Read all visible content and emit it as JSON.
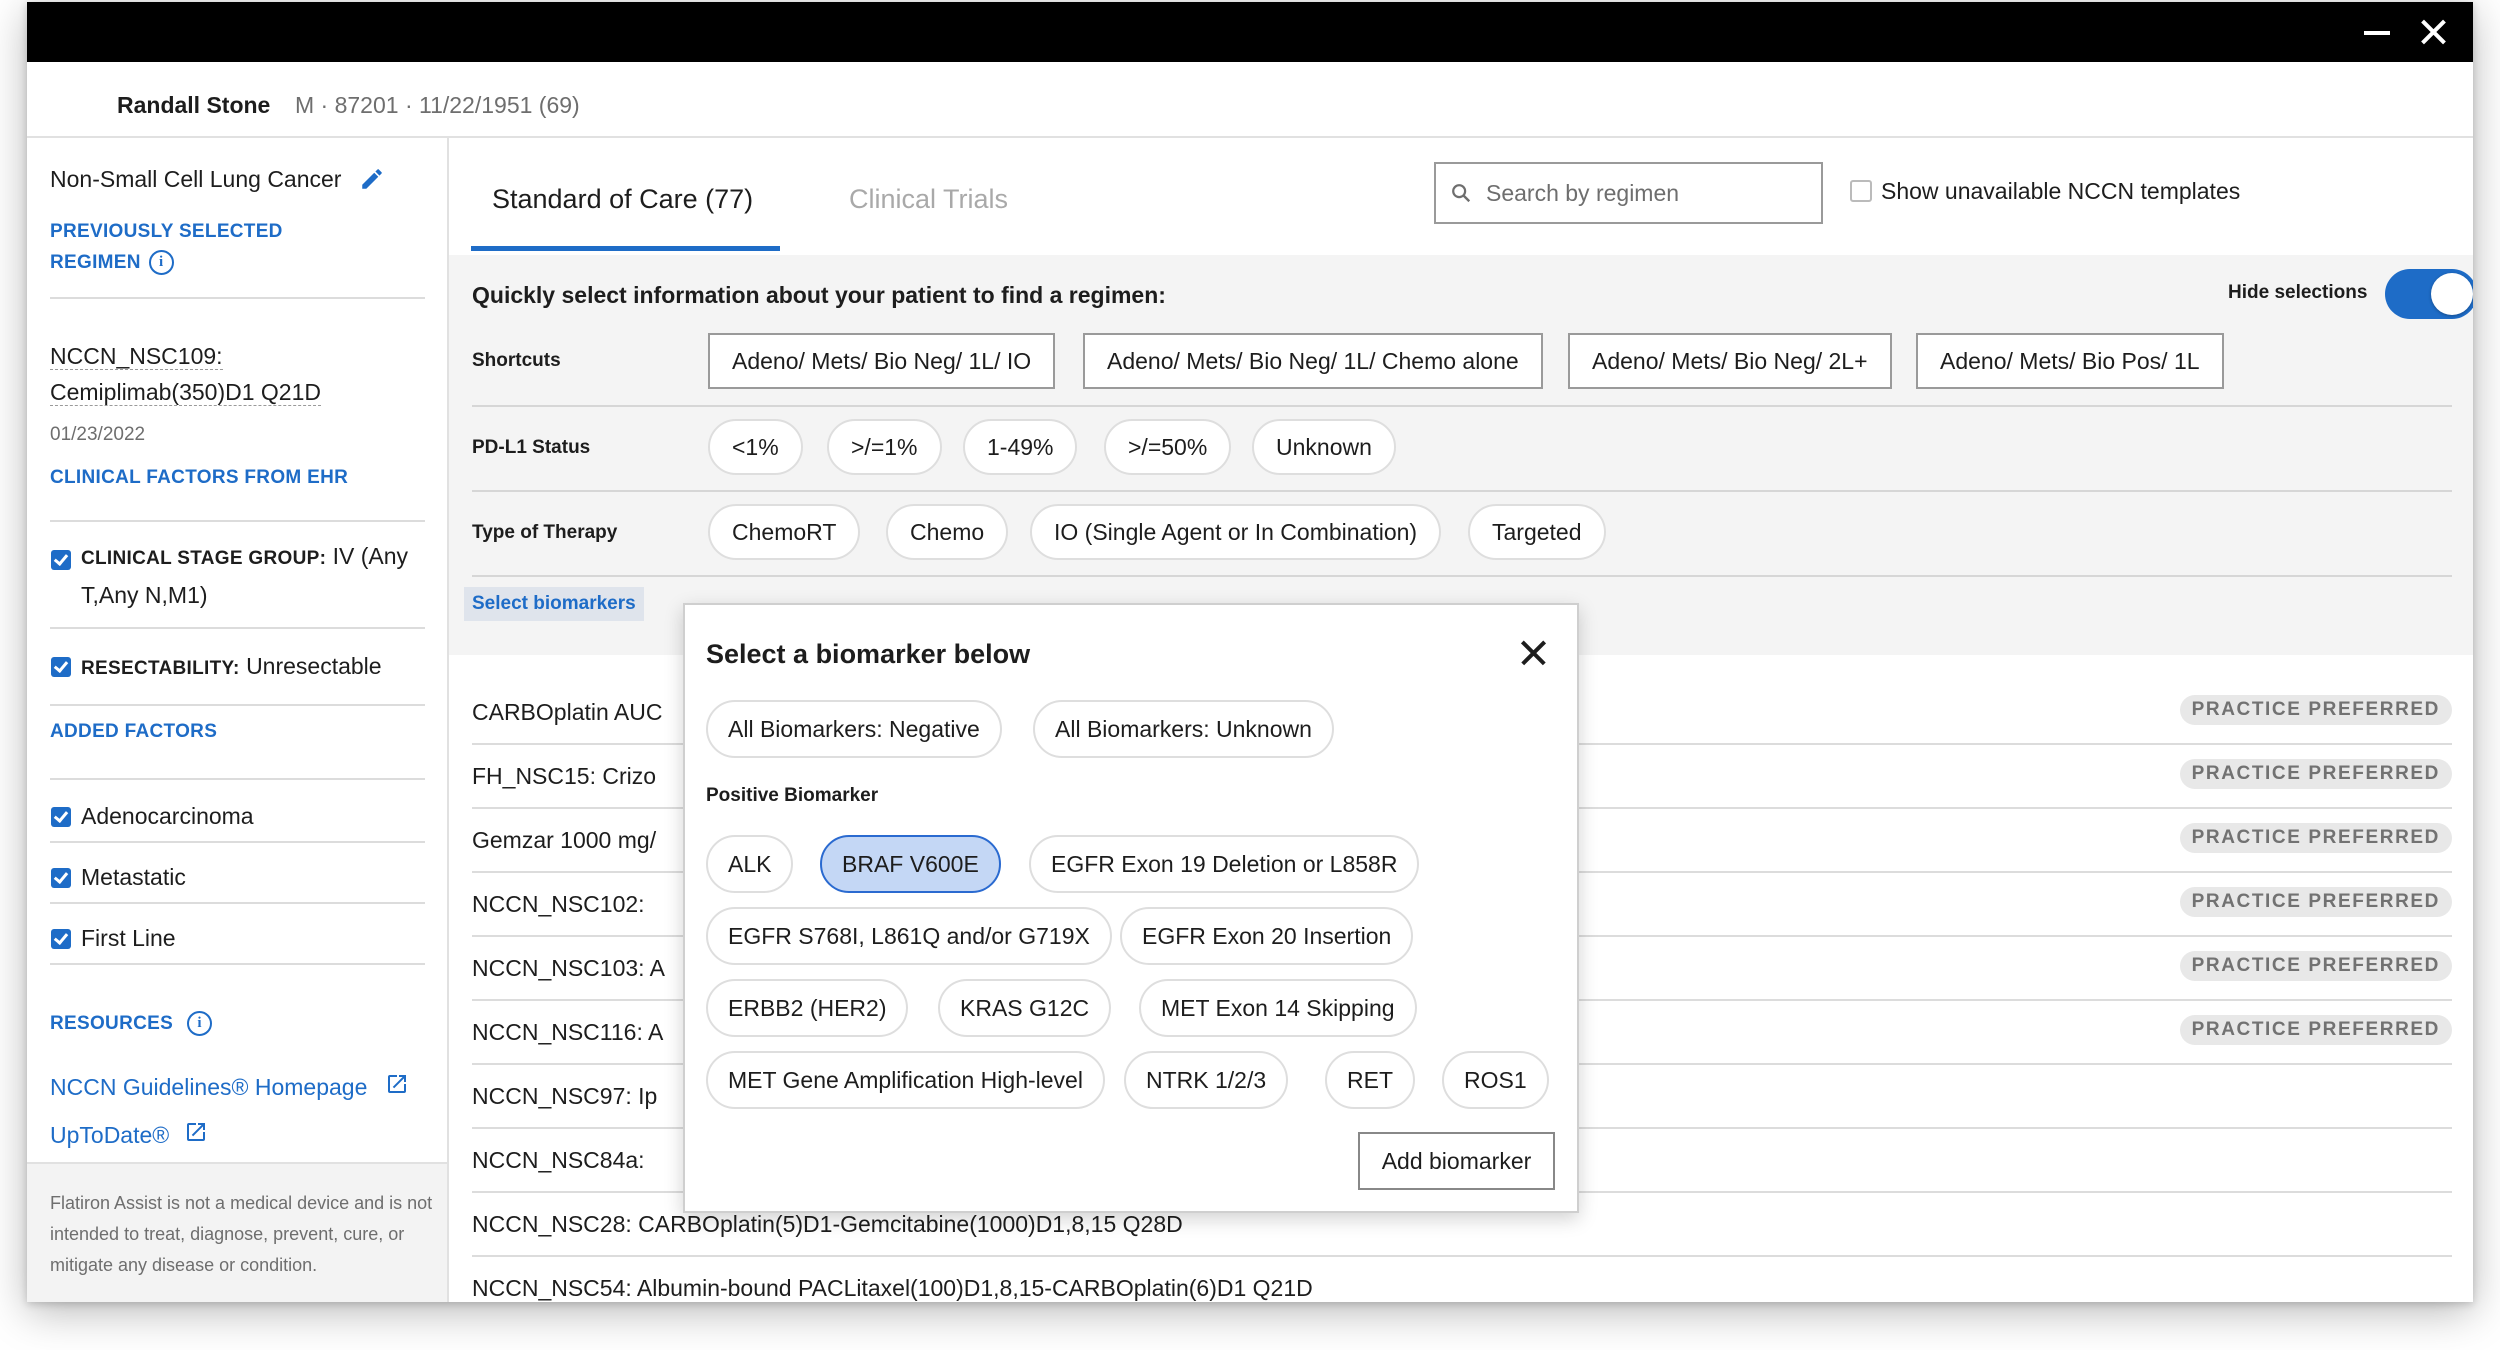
{
  "patient": {
    "name": "Randall Stone",
    "info": "M · 87201 · 11/22/1951 (69)"
  },
  "sidebar": {
    "diagnosis": "Non-Small Cell Lung Cancer",
    "previously_selected": {
      "title_line1": "PREVIOUSLY SELECTED",
      "title_line2": "REGIMEN",
      "regimen_line1": "NCCN_NSC109:",
      "regimen_line2": "Cemiplimab(350)D1 Q21D",
      "date": "01/23/2022"
    },
    "clinical_factors": {
      "title": "CLINICAL FACTORS FROM EHR",
      "items": [
        {
          "label": "CLINICAL STAGE GROUP:",
          "value_line1": "IV (Any",
          "value_line2": "T,Any N,M1)"
        },
        {
          "label": "RESECTABILITY:",
          "value": "Unresectable"
        }
      ]
    },
    "added_factors": {
      "title": "ADDED FACTORS",
      "items": [
        "Adenocarcinoma",
        "Metastatic",
        "First Line"
      ]
    },
    "resources": {
      "title": "RESOURCES",
      "links": [
        "NCCN Guidelines® Homepage",
        "UpToDate®"
      ]
    },
    "disclaimer": "Flatiron Assist is not a medical device and is not intended to treat, diagnose, prevent, cure, or mitigate any disease or condition."
  },
  "tabs": [
    {
      "label": "Standard of Care (77)",
      "active": true
    },
    {
      "label": "Clinical Trials",
      "active": false
    }
  ],
  "search": {
    "placeholder": "Search by regimen"
  },
  "show_unavailable": {
    "label": "Show unavailable NCCN templates",
    "checked": false
  },
  "filters": {
    "title": "Quickly select information about your patient to find a regimen:",
    "hide_selections_label": "Hide selections",
    "hide_selections_on": true,
    "shortcuts": {
      "label": "Shortcuts",
      "items": [
        "Adeno/ Mets/ Bio Neg/ 1L/ IO",
        "Adeno/ Mets/ Bio Neg/ 1L/ Chemo alone",
        "Adeno/ Mets/ Bio Neg/ 2L+",
        "Adeno/ Mets/ Bio Pos/ 1L"
      ]
    },
    "pdl1": {
      "label": "PD-L1 Status",
      "items": [
        "<1%",
        ">/=1%",
        "1-49%",
        ">/=50%",
        "Unknown"
      ]
    },
    "therapy": {
      "label": "Type of Therapy",
      "items": [
        "ChemoRT",
        "Chemo",
        "IO (Single Agent or In Combination)",
        "Targeted"
      ]
    },
    "select_biomarkers": "Select biomarkers"
  },
  "regimens": [
    {
      "text": "CARBOplatin AUC",
      "badge": "PRACTICE PREFERRED"
    },
    {
      "text": "FH_NSC15: Crizo",
      "badge": "PRACTICE PREFERRED"
    },
    {
      "text": "Gemzar 1000 mg/",
      "badge": "PRACTICE PREFERRED"
    },
    {
      "text": "NCCN_NSC102:",
      "badge": "PRACTICE PREFERRED"
    },
    {
      "text": "NCCN_NSC103: A",
      "badge": "PRACTICE PREFERRED"
    },
    {
      "text": "NCCN_NSC116: A",
      "badge": "PRACTICE PREFERRED"
    },
    {
      "text": "NCCN_NSC97: Ip",
      "badge": ""
    },
    {
      "text": "NCCN_NSC84a:",
      "badge": ""
    },
    {
      "text": "NCCN_NSC28: CARBOplatin(5)D1-Gemcitabine(1000)D1,8,15 Q28D",
      "badge": ""
    },
    {
      "text": "NCCN_NSC54: Albumin-bound PACLitaxel(100)D1,8,15-CARBOplatin(6)D1 Q21D",
      "badge": ""
    }
  ],
  "biomarker_popup": {
    "title": "Select a biomarker below",
    "general": [
      "All Biomarkers: Negative",
      "All Biomarkers: Unknown"
    ],
    "positive_label": "Positive Biomarker",
    "positive": [
      "ALK",
      "BRAF V600E",
      "EGFR Exon 19 Deletion or L858R",
      "EGFR S768I, L861Q and/or G719X",
      "EGFR Exon 20 Insertion",
      "ERBB2 (HER2)",
      "KRAS G12C",
      "MET Exon 14 Skipping",
      "MET Gene Amplification High-level",
      "NTRK 1/2/3",
      "RET",
      "ROS1"
    ],
    "selected": "BRAF V600E",
    "add_button": "Add biomarker"
  },
  "colors": {
    "accent": "#1e6cc7",
    "selected_chip": "#c4d7f5",
    "titlebar": "#000000"
  }
}
